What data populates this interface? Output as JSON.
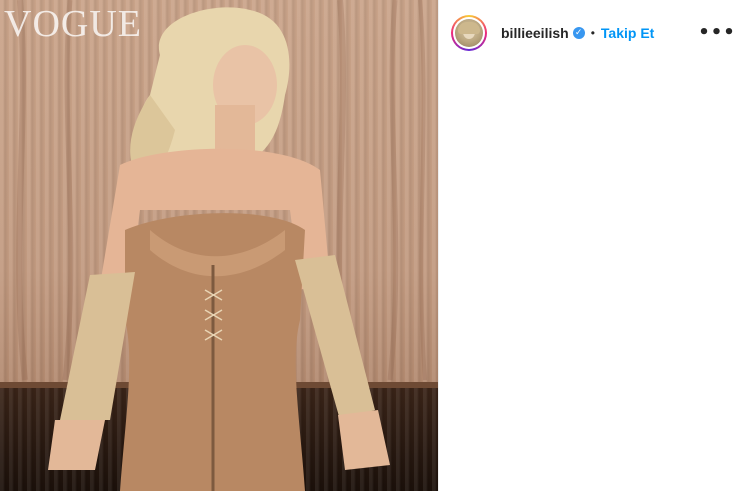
{
  "photo": {
    "magazine_mark": "VOGUE"
  },
  "header": {
    "username": "billieeilish",
    "verified_icon": "verified-badge-icon",
    "separator": "•",
    "follow_label": "Takip Et",
    "more_icon": "more-options-icon",
    "more_glyph": "•••"
  },
  "colors": {
    "follow_blue": "#0095f6",
    "verified_blue": "#3897f0",
    "text": "#262626"
  }
}
